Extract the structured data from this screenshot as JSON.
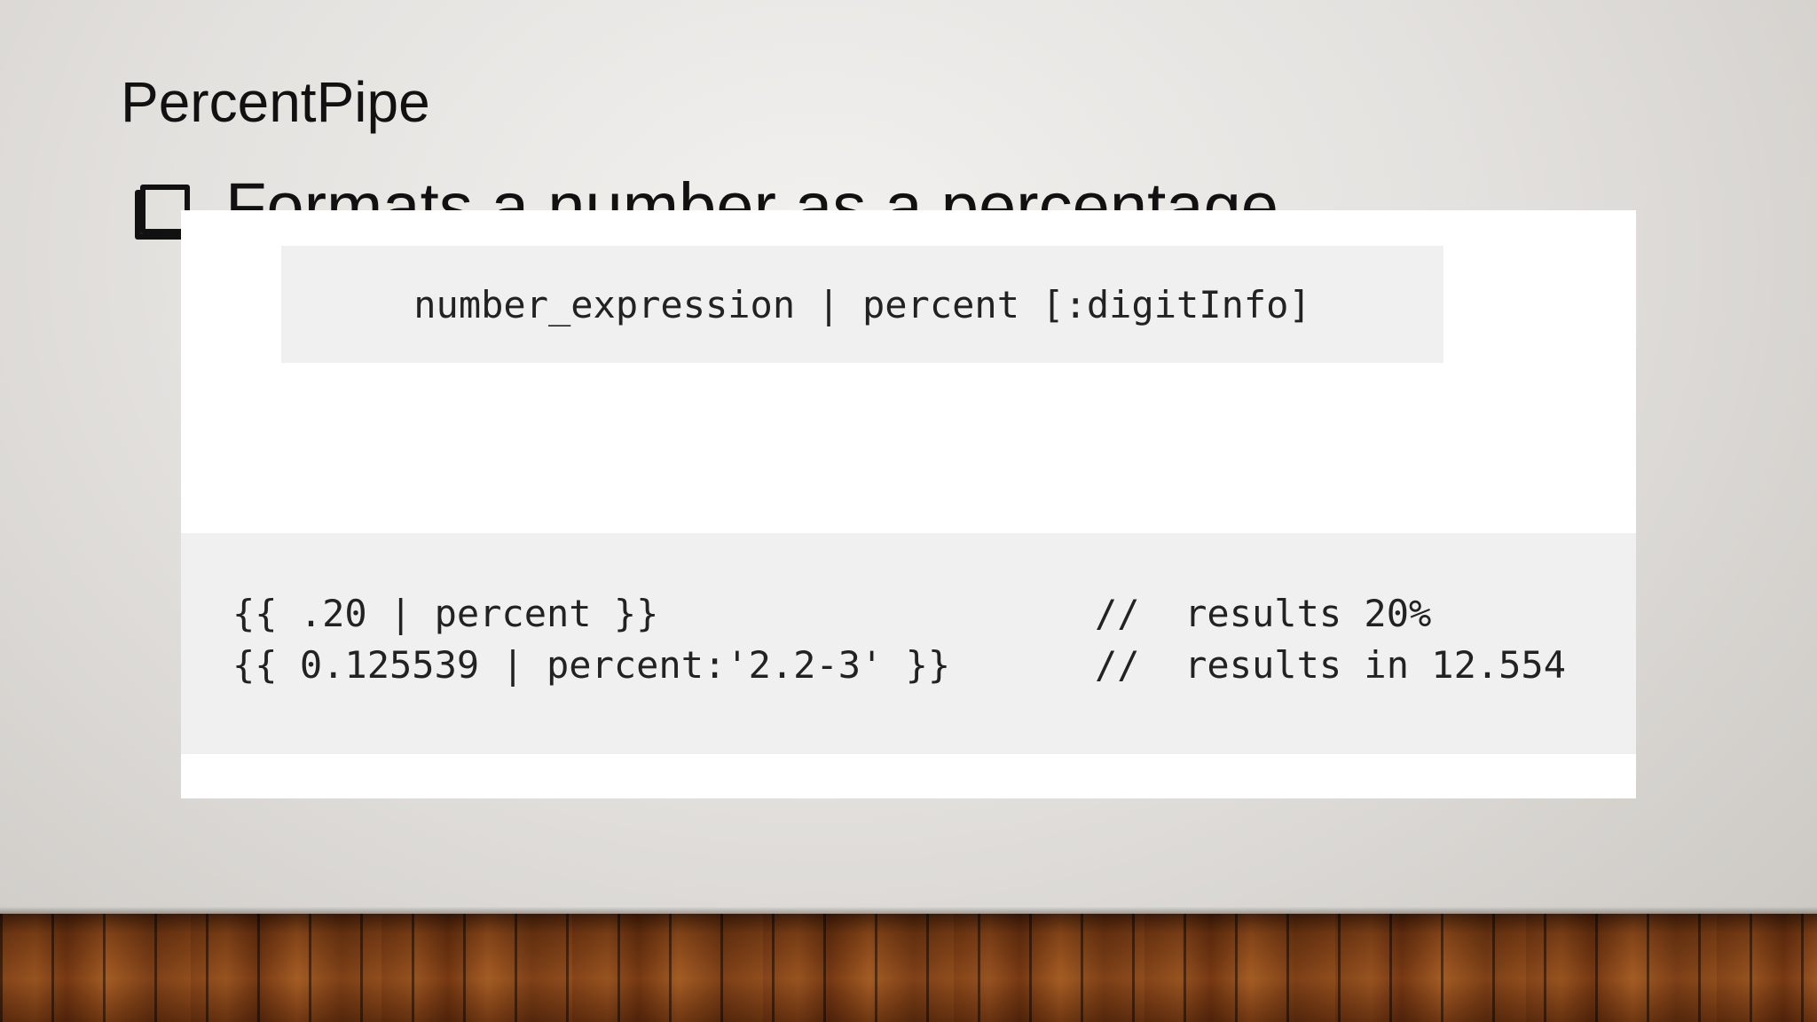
{
  "slide": {
    "title": "PercentPipe",
    "bullet": "Formats a number as a percentage",
    "syntax": "number_expression | percent [:digitInfo]",
    "examples": [
      {
        "code": "{{ .20 | percent }}",
        "comment": "//  results 20%"
      },
      {
        "code": "{{ 0.125539 | percent:'2.2-3' }}",
        "comment": "//  results in 12.554"
      }
    ]
  }
}
